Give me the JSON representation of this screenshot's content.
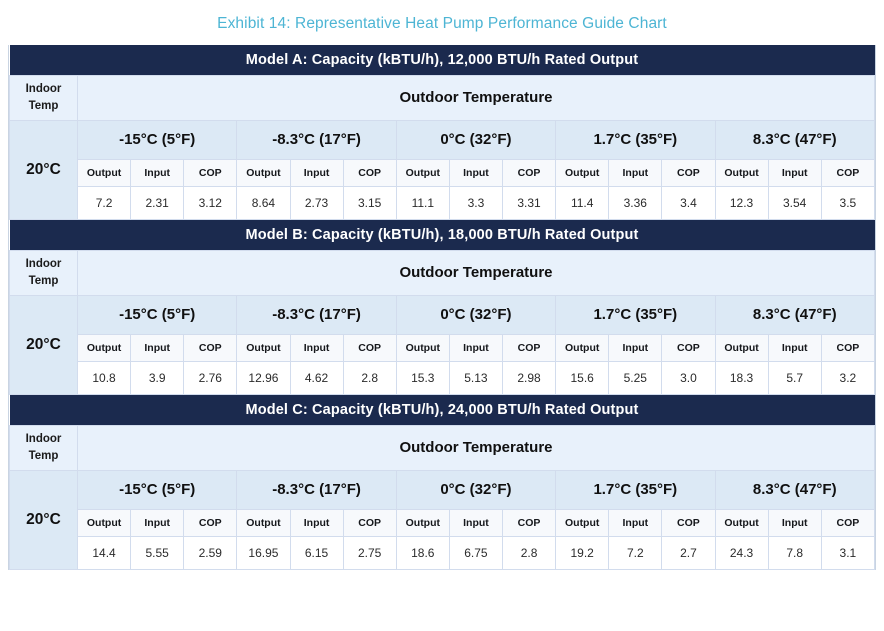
{
  "title": "Exhibit 14: Representative Heat Pump Performance Guide Chart",
  "colors": {
    "title_text": "#4db5d4",
    "banner_bg": "#1b2a4e",
    "banner_text": "#ffffff",
    "header_light_blue": "#e8f1fb",
    "header_mid_blue": "#dce9f5",
    "metric_header_bg": "#f7f9fc",
    "cell_bg": "#ffffff",
    "border": "#d2dced"
  },
  "labels": {
    "indoor_temp": "Indoor\nTemp",
    "indoor_temp_line1": "Indoor",
    "indoor_temp_line2": "Temp",
    "outdoor_temperature": "Outdoor Temperature",
    "indoor_temp_value": "20°C"
  },
  "metric_headers": [
    "Output",
    "Input",
    "COP"
  ],
  "outdoor_temperatures": [
    "-15°C (5°F)",
    "-8.3°C (17°F)",
    "0°C (32°F)",
    "1.7°C (35°F)",
    "8.3°C (47°F)"
  ],
  "chart_data": {
    "type": "table",
    "title": "Exhibit 14: Representative Heat Pump Performance Guide Chart",
    "xlabel": "Outdoor Temperature",
    "ylabel": "Indoor Temp",
    "columns": [
      "Output",
      "Input",
      "COP"
    ],
    "categories": [
      "-15°C (5°F)",
      "-8.3°C (17°F)",
      "0°C (32°F)",
      "1.7°C (35°F)",
      "8.3°C (47°F)"
    ],
    "indoor_temp": "20°C",
    "units": "kBTU/h",
    "series": [
      {
        "name": "Model A: Capacity (kBTU/h), 12,000 BTU/h Rated Output",
        "rated_output": "12,000 BTU/h",
        "output": [
          7.2,
          8.64,
          11.1,
          11.4,
          12.3
        ],
        "input": [
          2.31,
          2.73,
          3.3,
          3.36,
          3.54
        ],
        "cop": [
          3.12,
          3.15,
          3.31,
          3.4,
          3.5
        ]
      },
      {
        "name": "Model B: Capacity (kBTU/h), 18,000 BTU/h Rated Output",
        "rated_output": "18,000 BTU/h",
        "output": [
          10.8,
          12.96,
          15.3,
          15.6,
          18.3
        ],
        "input": [
          3.9,
          4.62,
          5.13,
          5.25,
          5.7
        ],
        "cop": [
          2.76,
          2.8,
          2.98,
          3.0,
          3.2
        ]
      },
      {
        "name": "Model C: Capacity (kBTU/h), 24,000 BTU/h Rated Output",
        "rated_output": "24,000 BTU/h",
        "output": [
          14.4,
          16.95,
          18.6,
          19.2,
          24.3
        ],
        "input": [
          5.55,
          6.15,
          6.75,
          7.2,
          7.8
        ],
        "cop": [
          2.59,
          2.75,
          2.8,
          2.7,
          3.1
        ]
      }
    ]
  },
  "tables": [
    {
      "banner": "Model A: Capacity (kBTU/h), 12,000 BTU/h Rated Output",
      "values": [
        "7.2",
        "2.31",
        "3.12",
        "8.64",
        "2.73",
        "3.15",
        "11.1",
        "3.3",
        "3.31",
        "11.4",
        "3.36",
        "3.4",
        "12.3",
        "3.54",
        "3.5"
      ]
    },
    {
      "banner": "Model B: Capacity (kBTU/h), 18,000 BTU/h Rated Output",
      "values": [
        "10.8",
        "3.9",
        "2.76",
        "12.96",
        "4.62",
        "2.8",
        "15.3",
        "5.13",
        "2.98",
        "15.6",
        "5.25",
        "3.0",
        "18.3",
        "5.7",
        "3.2"
      ]
    },
    {
      "banner": "Model C: Capacity (kBTU/h), 24,000 BTU/h Rated Output",
      "values": [
        "14.4",
        "5.55",
        "2.59",
        "16.95",
        "6.15",
        "2.75",
        "18.6",
        "6.75",
        "2.8",
        "19.2",
        "7.2",
        "2.7",
        "24.3",
        "7.8",
        "3.1"
      ]
    }
  ]
}
